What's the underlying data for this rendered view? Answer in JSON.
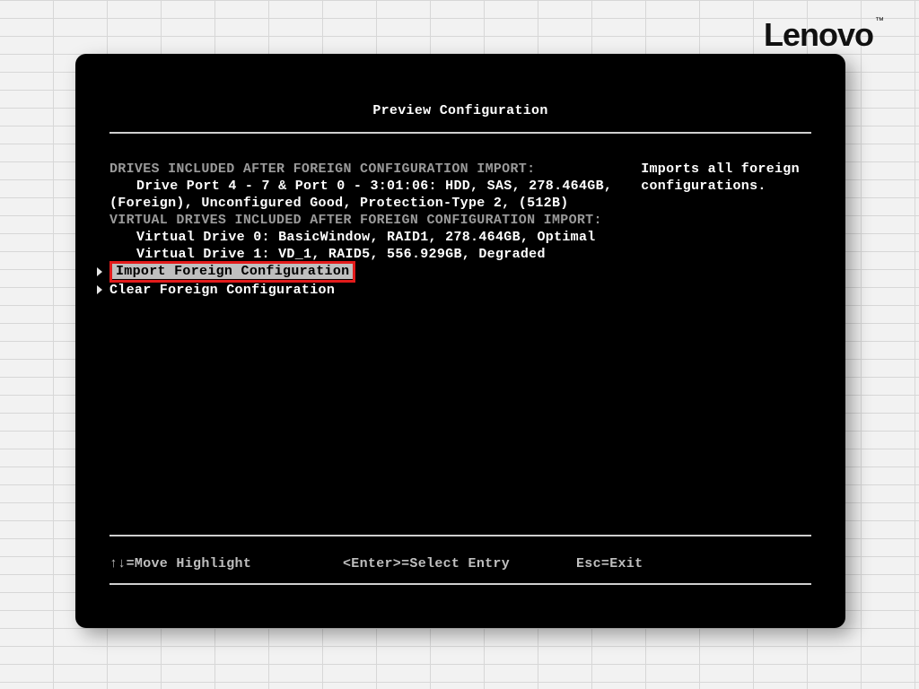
{
  "brand": "Lenovo",
  "title": "Preview Configuration",
  "left": {
    "drivesHeader": "DRIVES INCLUDED AFTER FOREIGN CONFIGURATION IMPORT:",
    "driveLine1": "Drive Port 4 - 7 & Port 0 - 3:01:06: HDD, SAS, 278.464GB,",
    "driveLine2": "(Foreign), Unconfigured Good, Protection-Type 2, (512B)",
    "vdHeader": "VIRTUAL DRIVES INCLUDED AFTER FOREIGN CONFIGURATION IMPORT:",
    "vd0": "Virtual Drive 0: BasicWindow, RAID1, 278.464GB, Optimal",
    "vd1": "Virtual Drive 1: VD_1, RAID5, 556.929GB, Degraded",
    "menu": {
      "import": "Import Foreign Configuration",
      "clear": "Clear Foreign Configuration"
    }
  },
  "right": {
    "help": "Imports all foreign configurations."
  },
  "footer": {
    "move": "↑↓=Move Highlight",
    "enter": "<Enter>=Select Entry",
    "esc": "Esc=Exit"
  }
}
